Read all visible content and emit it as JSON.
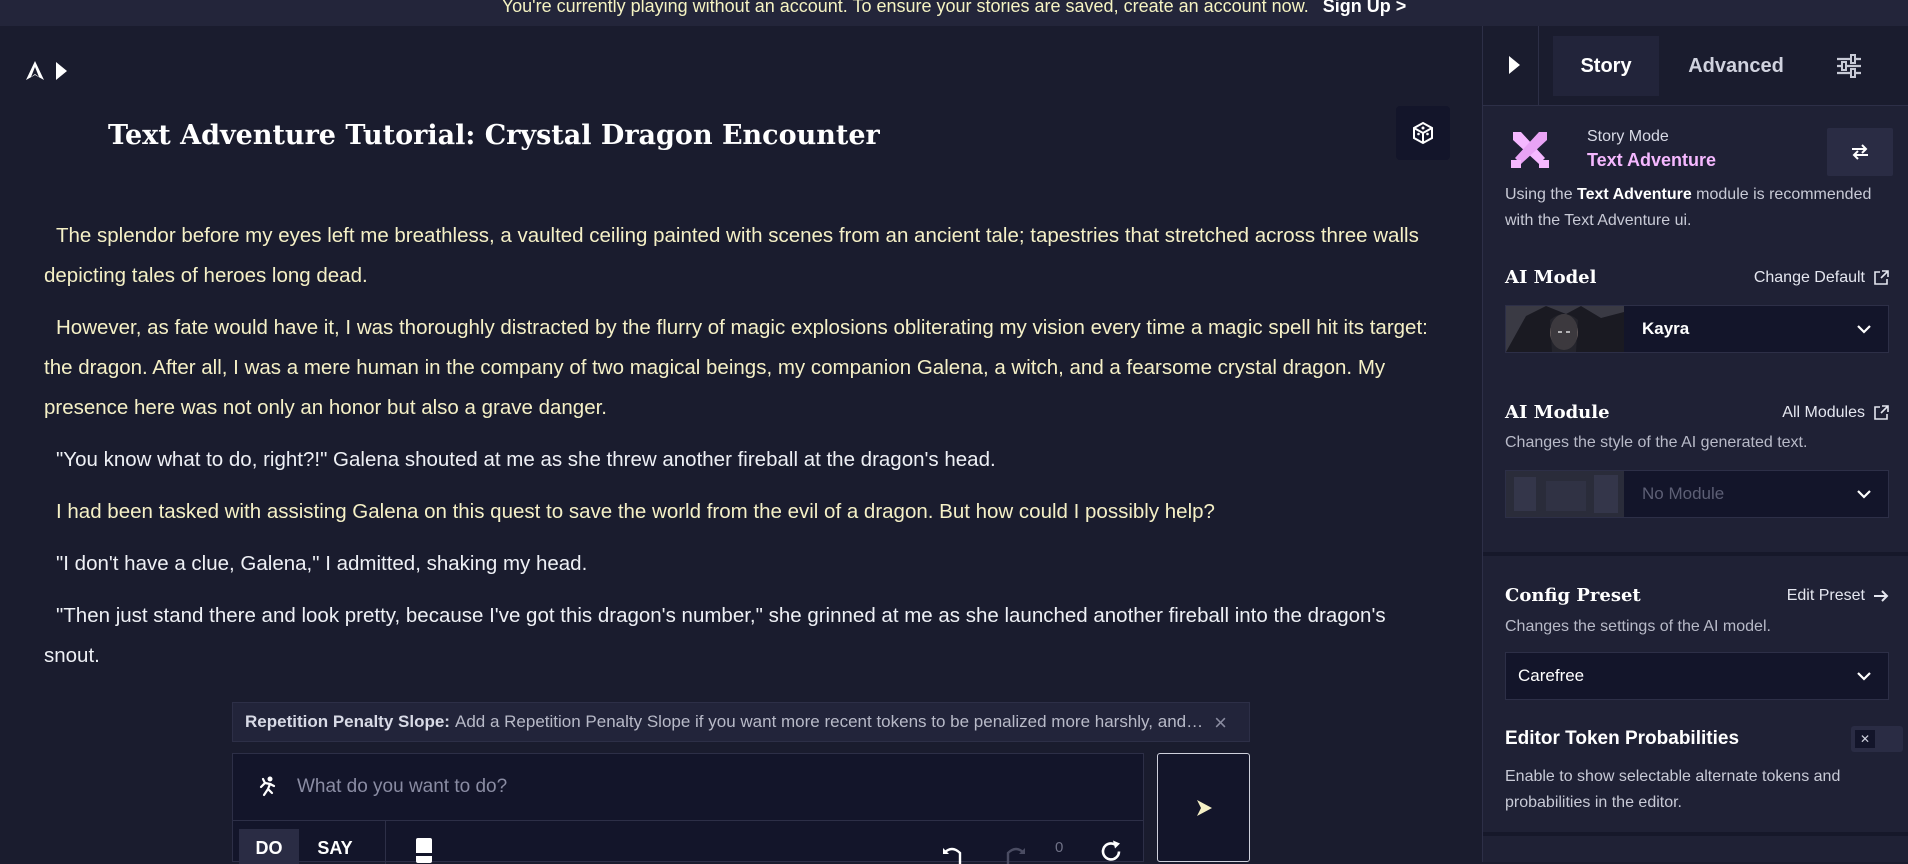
{
  "banner": {
    "message": "You're currently playing without an account. To ensure your stories are saved, create an account now.",
    "signup": "Sign Up >"
  },
  "story": {
    "title": "Text Adventure Tutorial: Crystal Dragon Encounter",
    "paragraphs": [
      "The splendor before my eyes left me breathless, a vaulted ceiling painted with scenes from an ancient tale; tapestries that stretched across three walls depicting tales of heroes long dead.",
      "However, as fate would have it, I was thoroughly distracted by the flurry of magic explosions obliterating my vision every time a magic spell hit its target: the dragon. After all, I was a mere human in the company of two magical beings, my companion Galena, a witch, and a fearsome crystal dragon. My presence here was not only an honor but also a grave danger.",
      "\"You know what to do, right?!\" Galena shouted at me as she threw another fireball at the dragon's head.",
      "I had been tasked with assisting Galena on this quest to save the world from the evil of a dragon. But how could I possibly help?",
      "\"I don't have a clue, Galena,\" I admitted, shaking my head.",
      "\"Then just stand there and look pretty, because I've got this dragon's number,\" she grinned at me as she launched another fireball into the dragon's snout."
    ]
  },
  "tip": {
    "label": "Repetition Penalty Slope:",
    "text": "Add a Repetition Penalty Slope if you want more recent tokens to be penalized more harshly, and…",
    "close": "×"
  },
  "input": {
    "placeholder": "What do you want to do?",
    "mode_do": "DO",
    "mode_say": "SAY",
    "redo_count": "0"
  },
  "panel": {
    "tabs": {
      "story": "Story",
      "advanced": "Advanced"
    },
    "story_mode": {
      "sub": "Story Mode",
      "value": "Text Adventure",
      "desc_pre": "Using the ",
      "desc_bold": "Text Adventure",
      "desc_post": " module is recommended with the Text Adventure ui."
    },
    "ai_model": {
      "title": "AI Model",
      "link": "Change Default",
      "selected": "Kayra"
    },
    "ai_module": {
      "title": "AI Module",
      "link": "All Modules",
      "desc": "Changes the style of the AI generated text.",
      "selected": "No Module"
    },
    "config_preset": {
      "title": "Config Preset",
      "link": "Edit Preset",
      "desc": "Changes the settings of the AI model.",
      "selected": "Carefree"
    },
    "token_probs": {
      "title": "Editor Token Probabilities",
      "desc": "Enable to show selectable alternate tokens and probabilities in the editor.",
      "toggle_glyph": "✕"
    }
  },
  "colors": {
    "background": "#1a1c2e",
    "panel": "#1f2135",
    "accent_pink": "#f5b8ff",
    "story_text": "#f5f0c6"
  },
  "icons": [
    "logo-icon",
    "play-icon",
    "dice-icon",
    "run-icon",
    "book-icon",
    "undo-icon",
    "redo-icon",
    "retry-icon",
    "send-icon",
    "settings-sliders-icon",
    "swords-icon",
    "swap-icon",
    "external-link-icon",
    "arrow-right-icon",
    "chevron-down-icon"
  ]
}
